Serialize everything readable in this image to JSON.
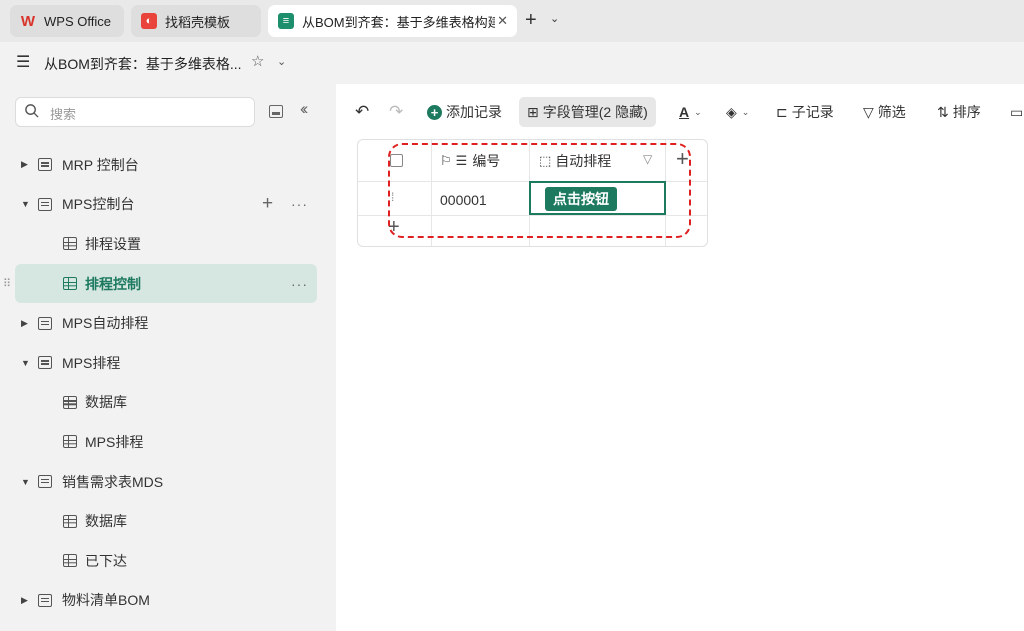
{
  "tabs": [
    {
      "label": "WPS Office",
      "icon": "wps-logo-icon",
      "color": "#d9342b"
    },
    {
      "label": "找稻壳模板",
      "icon": "docer-icon",
      "color": "#e8443b"
    },
    {
      "label": "从BOM到齐套：基于多维表格构建",
      "icon": "multi-dim-table-icon",
      "color": "#1d8f6c",
      "active": true
    }
  ],
  "title_bar": {
    "title": "从BOM到齐套：基于多维表格..."
  },
  "sidebar": {
    "search_placeholder": "搜索",
    "items": [
      {
        "label": "MRP 控制台",
        "level": 1,
        "expanded": false
      },
      {
        "label": "MPS控制台",
        "level": 1,
        "expanded": true
      },
      {
        "label": "排程设置",
        "level": 2
      },
      {
        "label": "排程控制",
        "level": 2,
        "selected": true
      },
      {
        "label": "MPS自动排程",
        "level": 1,
        "expanded": false
      },
      {
        "label": "MPS排程",
        "level": 1,
        "expanded": true
      },
      {
        "label": "数据库",
        "level": 2
      },
      {
        "label": "MPS排程",
        "level": 2
      },
      {
        "label": "销售需求表MDS",
        "level": 1,
        "expanded": true
      },
      {
        "label": "数据库",
        "level": 2
      },
      {
        "label": "已下达",
        "level": 2
      },
      {
        "label": "物料清单BOM",
        "level": 1,
        "expanded": false
      }
    ]
  },
  "toolbar": {
    "add_record": "添加记录",
    "field_manage": "字段管理(2 隐藏)",
    "sub_record": "子记录",
    "filter": "筛选",
    "sort": "排序"
  },
  "table": {
    "columns": [
      "编号",
      "自动排程"
    ],
    "rows": [
      {
        "id": "000001",
        "button": "点击按钮"
      }
    ]
  },
  "colors": {
    "accent": "#1d7a5f",
    "annotation": "#e02020"
  }
}
